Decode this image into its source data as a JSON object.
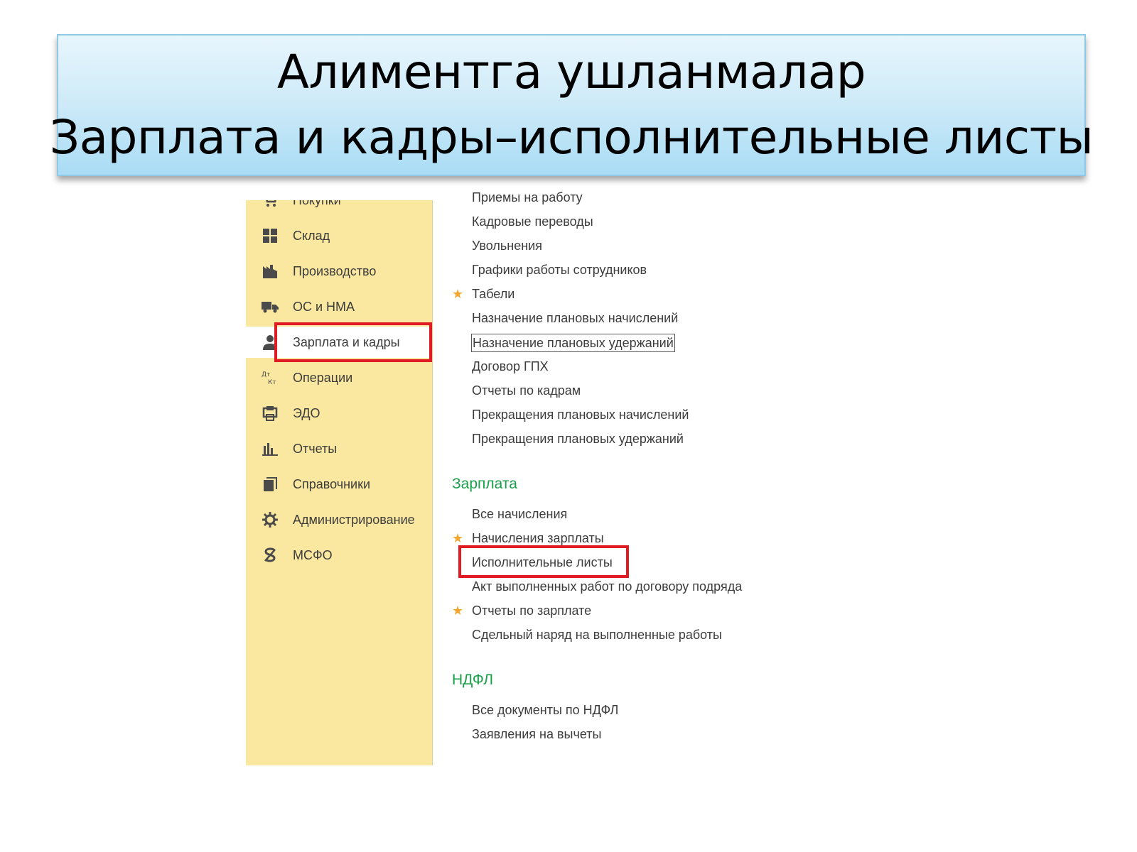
{
  "title": {
    "line1": "Алиментга ушланмалар",
    "line2": "Зарплата и кадры–исполнительные листы"
  },
  "sidebar": {
    "items": [
      {
        "label": "Покупки",
        "icon": "cart-icon"
      },
      {
        "label": "Склад",
        "icon": "warehouse-icon"
      },
      {
        "label": "Производство",
        "icon": "factory-icon"
      },
      {
        "label": "ОС и НМА",
        "icon": "truck-icon"
      },
      {
        "label": "Зарплата и кадры",
        "icon": "person-icon",
        "active": true
      },
      {
        "label": "Операции",
        "icon": "debit-credit-icon"
      },
      {
        "label": "ЭДО",
        "icon": "edo-icon"
      },
      {
        "label": "Отчеты",
        "icon": "bar-chart-icon"
      },
      {
        "label": "Справочники",
        "icon": "books-icon"
      },
      {
        "label": "Администрирование",
        "icon": "gear-icon"
      },
      {
        "label": "МСФО",
        "icon": "msfo-icon"
      }
    ]
  },
  "menu": {
    "hr_items": [
      "Приемы на работу",
      "Кадровые переводы",
      "Увольнения",
      "Графики работы сотрудников",
      "Табели",
      "Назначение плановых начислений",
      "Назначение плановых удержаний",
      "Договор ГПХ",
      "Отчеты по кадрам",
      "Прекращения плановых начислений",
      "Прекращения плановых удержаний"
    ],
    "salary_heading": "Зарплата",
    "salary_items": [
      "Все начисления",
      "Начисления зарплаты",
      "Исполнительные листы",
      "Акт выполненных работ по договору подряда",
      "Отчеты по зарплате",
      "Сдельный наряд на выполненные работы"
    ],
    "ndfl_heading": "НДФЛ",
    "ndfl_items": [
      "Все документы по НДФЛ",
      "Заявления на вычеты"
    ]
  },
  "colors": {
    "sidebar_bg": "#fbe8a0",
    "highlight_frame": "#e01b24",
    "section_heading": "#1aa04a",
    "star": "#f4a52b"
  }
}
